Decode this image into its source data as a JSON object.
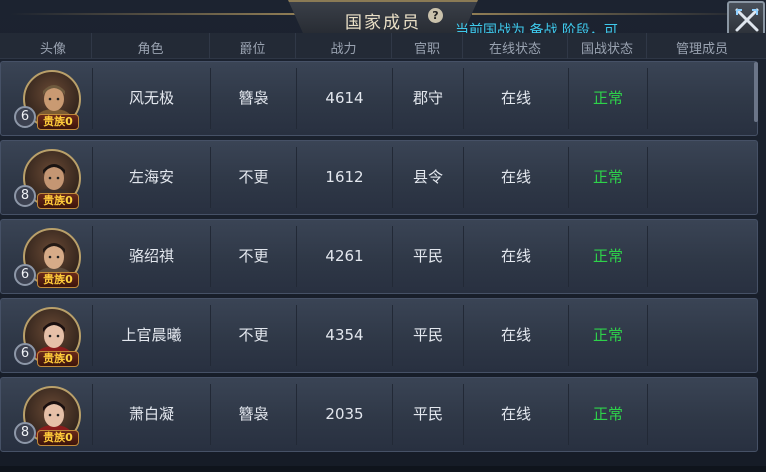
{
  "window": {
    "title": "国家成员",
    "help_icon": "question-mark-icon",
    "notice": "当前国战为 备战 阶段，可",
    "close_icon": "crossed-swords-close-icon"
  },
  "columns": {
    "avatar": "头像",
    "role": "角色",
    "rank": "爵位",
    "power": "战力",
    "office": "官职",
    "online": "在线状态",
    "war_status": "国战状态",
    "manage": "管理成员"
  },
  "members": [
    {
      "level": "6",
      "noble_label": "贵族",
      "noble_value": "0",
      "name": "风无极",
      "rank": "簪袅",
      "power": "4614",
      "office": "郡守",
      "online": "在线",
      "war_status": "正常",
      "portrait": "helmeted-warrior-portrait"
    },
    {
      "level": "8",
      "noble_label": "贵族",
      "noble_value": "0",
      "name": "左海安",
      "rank": "不更",
      "power": "1612",
      "office": "县令",
      "online": "在线",
      "war_status": "正常",
      "portrait": "bearded-official-portrait"
    },
    {
      "level": "6",
      "noble_label": "贵族",
      "noble_value": "0",
      "name": "骆绍祺",
      "rank": "不更",
      "power": "4261",
      "office": "平民",
      "online": "在线",
      "war_status": "正常",
      "portrait": "young-man-portrait"
    },
    {
      "level": "6",
      "noble_label": "贵族",
      "noble_value": "0",
      "name": "上官晨曦",
      "rank": "不更",
      "power": "4354",
      "office": "平民",
      "online": "在线",
      "war_status": "正常",
      "portrait": "woman-portrait"
    },
    {
      "level": "8",
      "noble_label": "贵族",
      "noble_value": "0",
      "name": "萧白凝",
      "rank": "簪袅",
      "power": "2035",
      "office": "平民",
      "online": "在线",
      "war_status": "正常",
      "portrait": "woman-portrait"
    }
  ],
  "colors": {
    "status_ok": "#2ed24a",
    "notice": "#3fc9ec",
    "noble": "#ffcb3a"
  }
}
